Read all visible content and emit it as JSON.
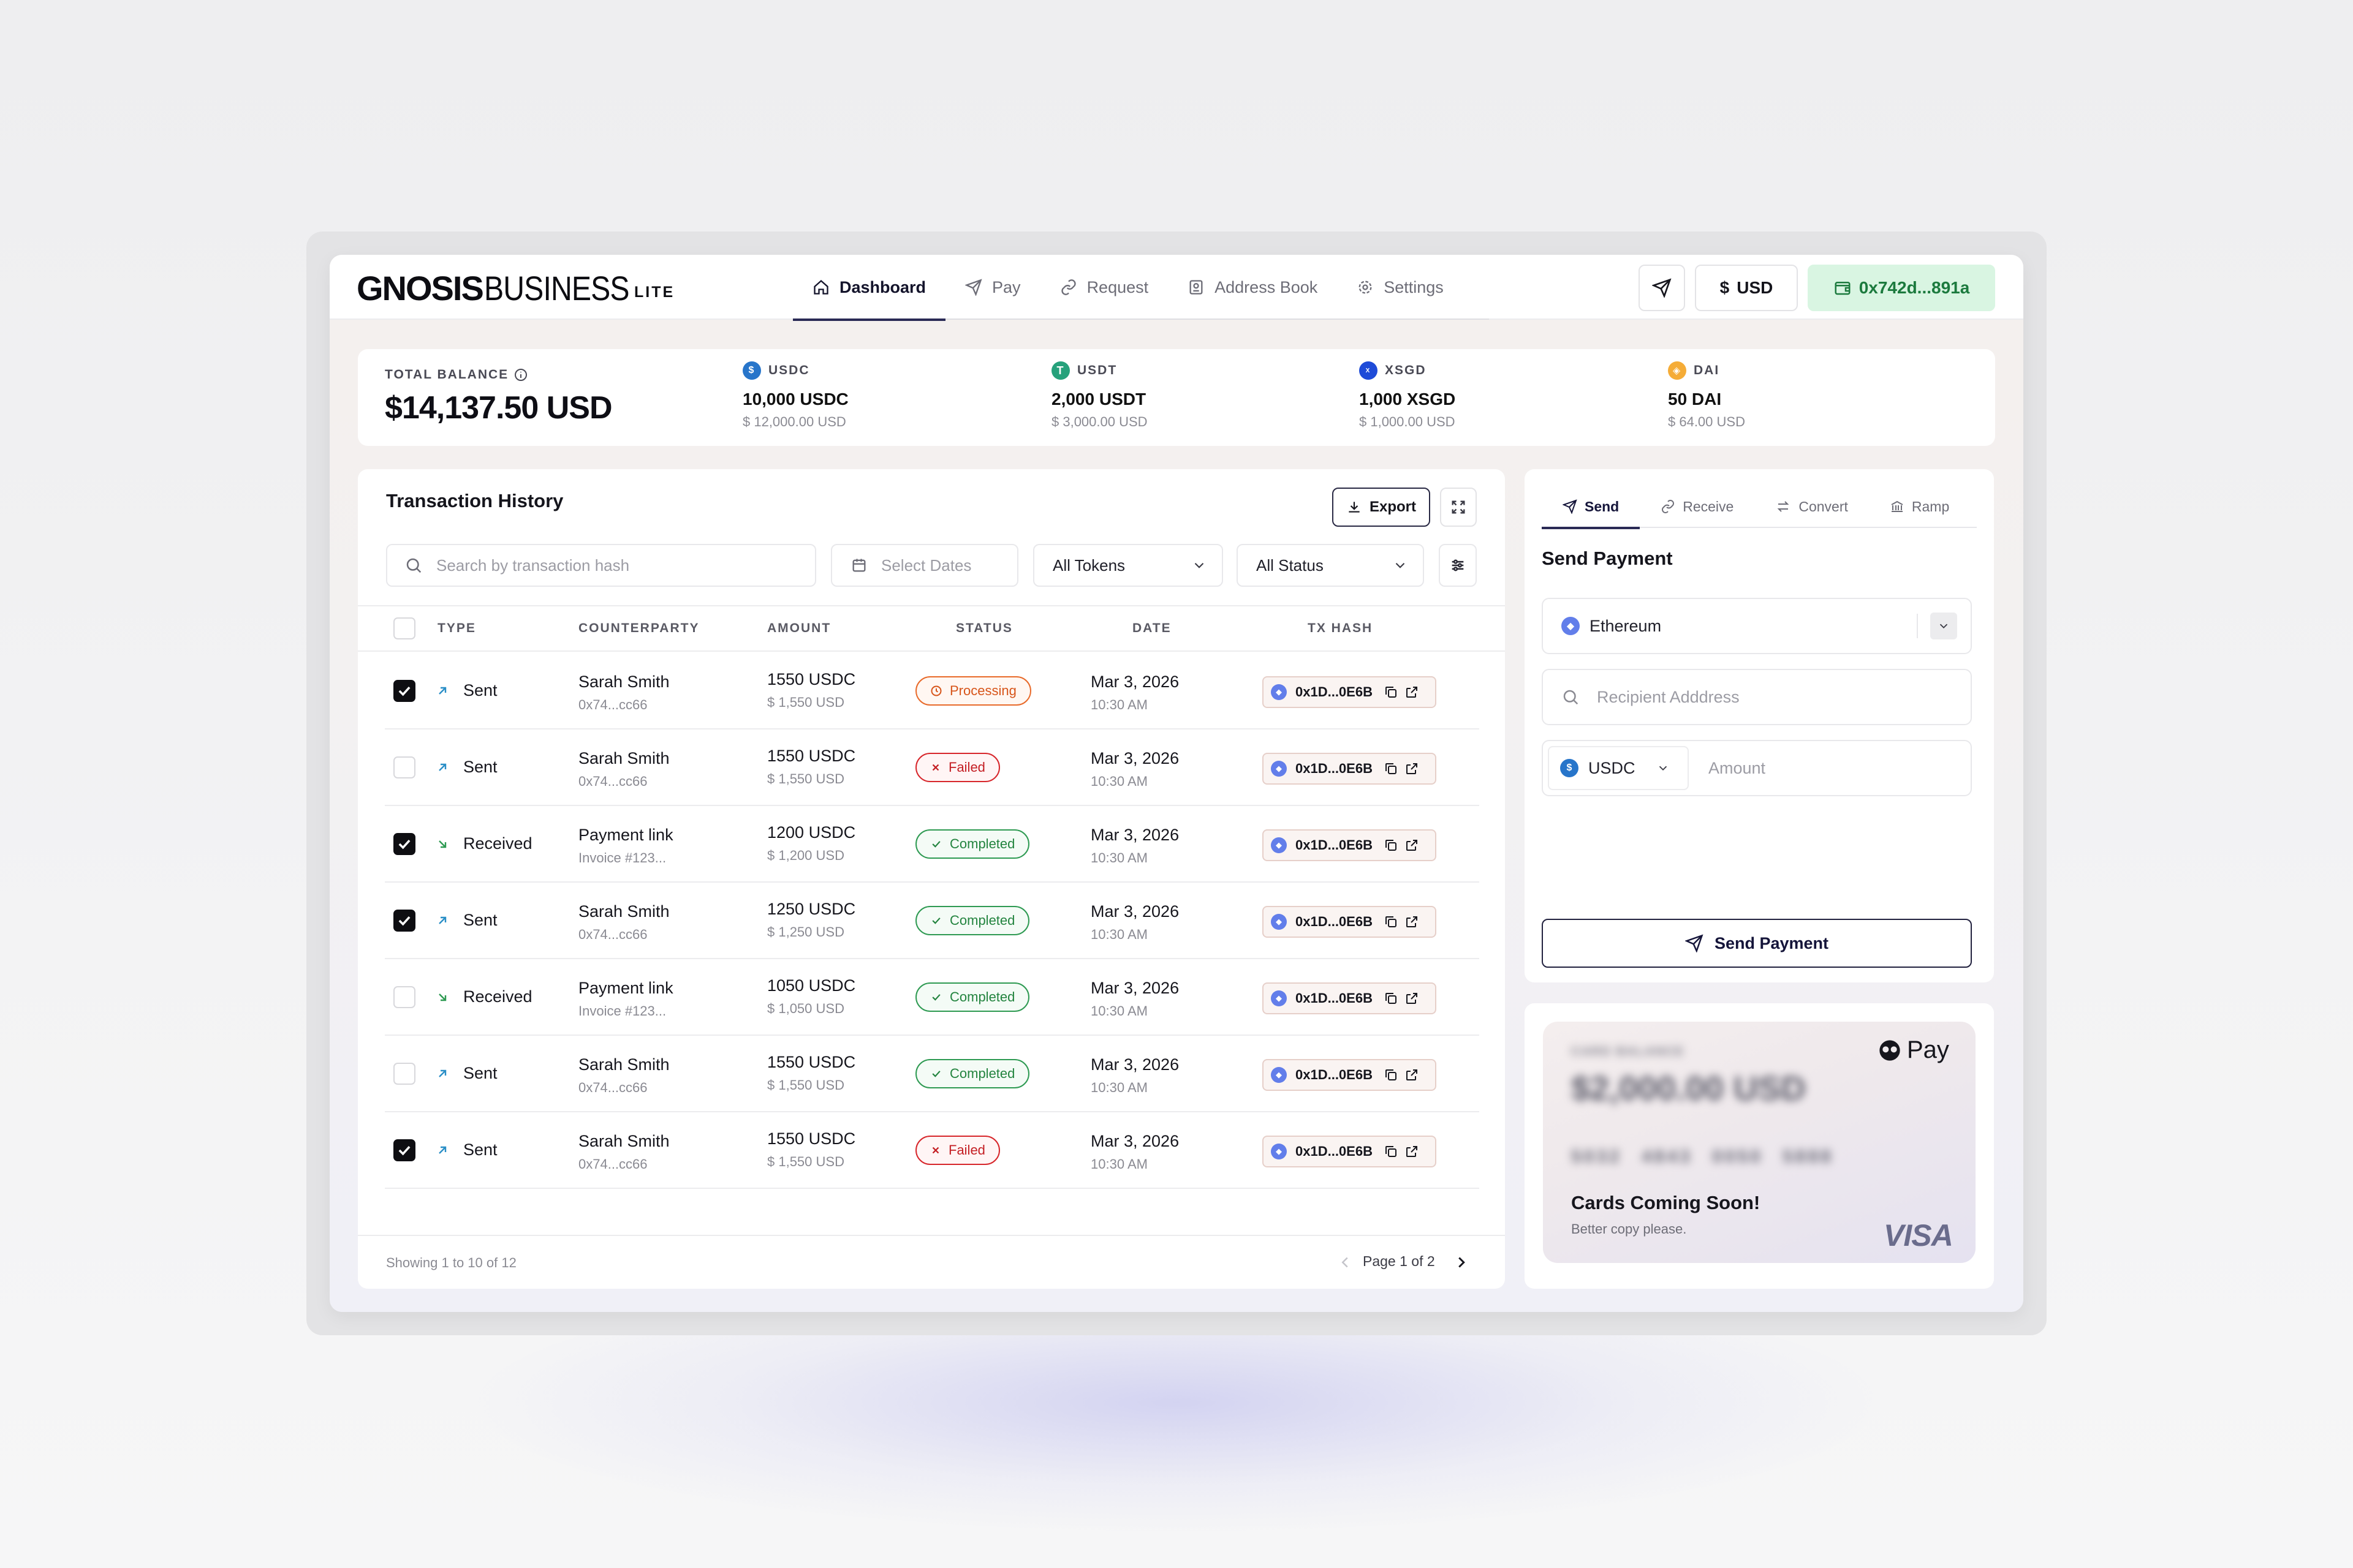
{
  "header": {
    "logo": {
      "gnosis": "GNOSIS",
      "business": "BUSINESS",
      "lite": "LITE"
    },
    "nav": [
      {
        "label": "Dashboard",
        "icon": "home-icon",
        "active": true
      },
      {
        "label": "Pay",
        "icon": "send-icon",
        "active": false
      },
      {
        "label": "Request",
        "icon": "link-icon",
        "active": false
      },
      {
        "label": "Address Book",
        "icon": "book-icon",
        "active": false
      },
      {
        "label": "Settings",
        "icon": "gear-icon",
        "active": false
      }
    ],
    "currency": "USD",
    "currency_symbol": "$",
    "wallet": "0x742d...891a"
  },
  "balance": {
    "label": "TOTAL BALANCE",
    "total": "$14,137.50 USD",
    "tokens": [
      {
        "symbol": "USDC",
        "amount": "10,000 USDC",
        "usd": "$ 12,000.00 USD",
        "color": "#2775ca"
      },
      {
        "symbol": "USDT",
        "amount": "2,000 USDT",
        "usd": "$ 3,000.00 USD",
        "color": "#26a17b"
      },
      {
        "symbol": "XSGD",
        "amount": "1,000 XSGD",
        "usd": "$ 1,000.00 USD",
        "color": "#1e4bd8"
      },
      {
        "symbol": "DAI",
        "amount": "50 DAI",
        "usd": "$ 64.00 USD",
        "color": "#f5ac37"
      }
    ]
  },
  "transactions": {
    "title": "Transaction History",
    "export_label": "Export",
    "search_placeholder": "Search by transaction hash",
    "dates_placeholder": "Select Dates",
    "tokens_filter": "All Tokens",
    "status_filter": "All Status",
    "columns": [
      "TYPE",
      "COUNTERPARTY",
      "AMOUNT",
      "STATUS",
      "DATE",
      "TX HASH"
    ],
    "rows": [
      {
        "checked": true,
        "type": "Sent",
        "cp_name": "Sarah Smith",
        "cp_sub": "0x74...cc66",
        "amount": "1550 USDC",
        "amount_usd": "$ 1,550 USD",
        "status": "Processing",
        "date": "Mar 3, 2026",
        "time": "10:30 AM",
        "hash": "0x1D...0E6B"
      },
      {
        "checked": false,
        "type": "Sent",
        "cp_name": "Sarah Smith",
        "cp_sub": "0x74...cc66",
        "amount": "1550 USDC",
        "amount_usd": "$ 1,550 USD",
        "status": "Failed",
        "date": "Mar 3, 2026",
        "time": "10:30 AM",
        "hash": "0x1D...0E6B"
      },
      {
        "checked": true,
        "type": "Received",
        "cp_name": "Payment link",
        "cp_sub": "Invoice #123...",
        "amount": "1200 USDC",
        "amount_usd": "$ 1,200 USD",
        "status": "Completed",
        "date": "Mar 3, 2026",
        "time": "10:30 AM",
        "hash": "0x1D...0E6B"
      },
      {
        "checked": true,
        "type": "Sent",
        "cp_name": "Sarah Smith",
        "cp_sub": "0x74...cc66",
        "amount": "1250 USDC",
        "amount_usd": "$ 1,250 USD",
        "status": "Completed",
        "date": "Mar 3, 2026",
        "time": "10:30 AM",
        "hash": "0x1D...0E6B"
      },
      {
        "checked": false,
        "type": "Received",
        "cp_name": "Payment link",
        "cp_sub": "Invoice #123...",
        "amount": "1050 USDC",
        "amount_usd": "$ 1,050 USD",
        "status": "Completed",
        "date": "Mar 3, 2026",
        "time": "10:30 AM",
        "hash": "0x1D...0E6B"
      },
      {
        "checked": false,
        "type": "Sent",
        "cp_name": "Sarah Smith",
        "cp_sub": "0x74...cc66",
        "amount": "1550 USDC",
        "amount_usd": "$ 1,550 USD",
        "status": "Completed",
        "date": "Mar 3, 2026",
        "time": "10:30 AM",
        "hash": "0x1D...0E6B"
      },
      {
        "checked": true,
        "type": "Sent",
        "cp_name": "Sarah Smith",
        "cp_sub": "0x74...cc66",
        "amount": "1550 USDC",
        "amount_usd": "$ 1,550 USD",
        "status": "Failed",
        "date": "Mar 3, 2026",
        "time": "10:30 AM",
        "hash": "0x1D...0E6B"
      }
    ],
    "showing": "Showing 1 to 10 of 12",
    "page": "Page 1 of 2"
  },
  "send": {
    "tabs": [
      {
        "label": "Send",
        "icon": "send-icon",
        "active": true
      },
      {
        "label": "Receive",
        "icon": "link-icon",
        "active": false
      },
      {
        "label": "Convert",
        "icon": "swap-icon",
        "active": false
      },
      {
        "label": "Ramp",
        "icon": "bank-icon",
        "active": false
      }
    ],
    "title": "Send Payment",
    "network": "Ethereum",
    "recipient_placeholder": "Recipient Adddress",
    "token": "USDC",
    "amount_placeholder": "Amount",
    "button": "Send Payment"
  },
  "card": {
    "balance_label": "CARD BALANCE",
    "balance": "$2,000.00 USD",
    "number": "5032 4843 0050 5888",
    "pay_label": "Pay",
    "coming": "Cards Coming Soon!",
    "copy": "Better copy please.",
    "brand": "VISA"
  },
  "colors": {
    "accent": "#2a2a55",
    "wallet_bg": "#d9f5e2",
    "wallet_text": "#1c7a3e",
    "processing": "#e86a2a",
    "failed": "#d7262b",
    "completed": "#2e9a52"
  }
}
